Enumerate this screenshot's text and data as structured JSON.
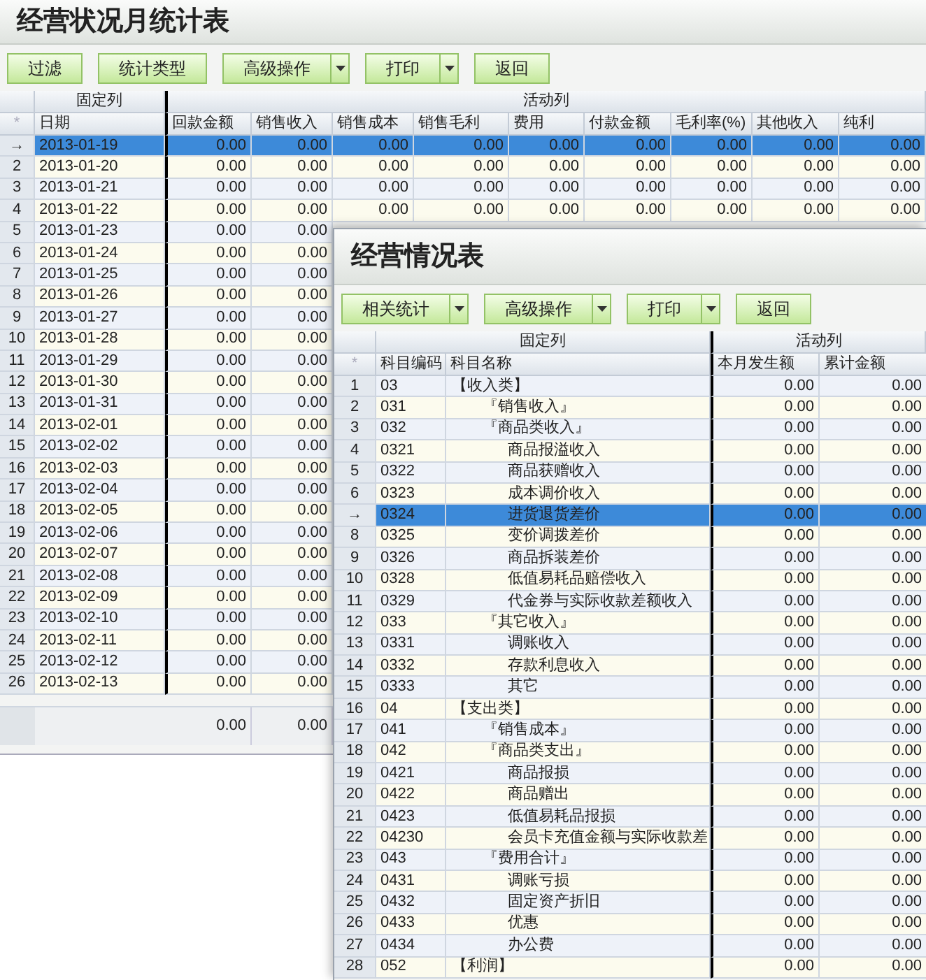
{
  "report_window": {
    "title": "经营状况月统计表",
    "toolbar": [
      {
        "label": "过滤",
        "kind": "plain"
      },
      {
        "label": "统计类型",
        "kind": "plain"
      },
      {
        "label": "高级操作",
        "kind": "split"
      },
      {
        "label": "打印",
        "kind": "split"
      },
      {
        "label": "返回",
        "kind": "plain"
      }
    ],
    "grid": {
      "groups": [
        "固定列",
        "活动列"
      ],
      "corner": "*",
      "columns": [
        "日期",
        "回款金额",
        "销售收入",
        "销售成本",
        "销售毛利",
        "费用",
        "付款金额",
        "毛利率(%)",
        "其他收入",
        "纯利"
      ],
      "rows": [
        {
          "row_no": "→",
          "selected": true,
          "date": "2013-01-19",
          "values": [
            "0.00",
            "0.00",
            "0.00",
            "0.00",
            "0.00",
            "0.00",
            "0.00",
            "0.00",
            "0.00"
          ]
        },
        {
          "row_no": "2",
          "selected": false,
          "date": "2013-01-20",
          "values": [
            "0.00",
            "0.00",
            "0.00",
            "0.00",
            "0.00",
            "0.00",
            "0.00",
            "0.00",
            "0.00"
          ]
        },
        {
          "row_no": "3",
          "selected": false,
          "date": "2013-01-21",
          "values": [
            "0.00",
            "0.00",
            "0.00",
            "0.00",
            "0.00",
            "0.00",
            "0.00",
            "0.00",
            "0.00"
          ]
        },
        {
          "row_no": "4",
          "selected": false,
          "date": "2013-01-22",
          "values": [
            "0.00",
            "0.00",
            "0.00",
            "0.00",
            "0.00",
            "0.00",
            "0.00",
            "0.00",
            "0.00"
          ]
        },
        {
          "row_no": "5",
          "selected": false,
          "date": "2013-01-23",
          "values": [
            "0.00",
            "0.00"
          ]
        },
        {
          "row_no": "6",
          "selected": false,
          "date": "2013-01-24",
          "values": [
            "0.00",
            "0.00"
          ]
        },
        {
          "row_no": "7",
          "selected": false,
          "date": "2013-01-25",
          "values": [
            "0.00",
            "0.00"
          ]
        },
        {
          "row_no": "8",
          "selected": false,
          "date": "2013-01-26",
          "values": [
            "0.00",
            "0.00"
          ]
        },
        {
          "row_no": "9",
          "selected": false,
          "date": "2013-01-27",
          "values": [
            "0.00",
            "0.00"
          ]
        },
        {
          "row_no": "10",
          "selected": false,
          "date": "2013-01-28",
          "values": [
            "0.00",
            "0.00"
          ]
        },
        {
          "row_no": "11",
          "selected": false,
          "date": "2013-01-29",
          "values": [
            "0.00",
            "0.00"
          ]
        },
        {
          "row_no": "12",
          "selected": false,
          "date": "2013-01-30",
          "values": [
            "0.00",
            "0.00"
          ]
        },
        {
          "row_no": "13",
          "selected": false,
          "date": "2013-01-31",
          "values": [
            "0.00",
            "0.00"
          ]
        },
        {
          "row_no": "14",
          "selected": false,
          "date": "2013-02-01",
          "values": [
            "0.00",
            "0.00"
          ]
        },
        {
          "row_no": "15",
          "selected": false,
          "date": "2013-02-02",
          "values": [
            "0.00",
            "0.00"
          ]
        },
        {
          "row_no": "16",
          "selected": false,
          "date": "2013-02-03",
          "values": [
            "0.00",
            "0.00"
          ]
        },
        {
          "row_no": "17",
          "selected": false,
          "date": "2013-02-04",
          "values": [
            "0.00",
            "0.00"
          ]
        },
        {
          "row_no": "18",
          "selected": false,
          "date": "2013-02-05",
          "values": [
            "0.00",
            "0.00"
          ]
        },
        {
          "row_no": "19",
          "selected": false,
          "date": "2013-02-06",
          "values": [
            "0.00",
            "0.00"
          ]
        },
        {
          "row_no": "20",
          "selected": false,
          "date": "2013-02-07",
          "values": [
            "0.00",
            "0.00"
          ]
        },
        {
          "row_no": "21",
          "selected": false,
          "date": "2013-02-08",
          "values": [
            "0.00",
            "0.00"
          ]
        },
        {
          "row_no": "22",
          "selected": false,
          "date": "2013-02-09",
          "values": [
            "0.00",
            "0.00"
          ]
        },
        {
          "row_no": "23",
          "selected": false,
          "date": "2013-02-10",
          "values": [
            "0.00",
            "0.00"
          ]
        },
        {
          "row_no": "24",
          "selected": false,
          "date": "2013-02-11",
          "values": [
            "0.00",
            "0.00"
          ]
        },
        {
          "row_no": "25",
          "selected": false,
          "date": "2013-02-12",
          "values": [
            "0.00",
            "0.00"
          ]
        },
        {
          "row_no": "26",
          "selected": false,
          "date": "2013-02-13",
          "values": [
            "0.00",
            "0.00"
          ]
        }
      ],
      "totals": [
        "0.00",
        "0.00"
      ]
    }
  },
  "detail_window": {
    "title": "经营情况表",
    "toolbar": [
      {
        "label": "相关统计",
        "kind": "split"
      },
      {
        "label": "高级操作",
        "kind": "split"
      },
      {
        "label": "打印",
        "kind": "split"
      },
      {
        "label": "返回",
        "kind": "plain"
      }
    ],
    "grid": {
      "groups": [
        "固定列",
        "活动列"
      ],
      "corner": "*",
      "columns": [
        "科目编码",
        "科目名称",
        "本月发生额",
        "累计金额"
      ],
      "rows": [
        {
          "row_no": "1",
          "selected": false,
          "code": "03",
          "name": "【收入类】",
          "this_month": "0.00",
          "cumulative": "0.00",
          "children": [
            {
              "row_no": "2",
              "selected": false,
              "code": "031",
              "name": "『销售收入』",
              "this_month": "0.00",
              "cumulative": "0.00"
            },
            {
              "row_no": "3",
              "selected": false,
              "code": "032",
              "name": "『商品类收入』",
              "this_month": "0.00",
              "cumulative": "0.00",
              "children": [
                {
                  "row_no": "4",
                  "selected": false,
                  "code": "0321",
                  "name": "商品报溢收入",
                  "this_month": "0.00",
                  "cumulative": "0.00"
                },
                {
                  "row_no": "5",
                  "selected": false,
                  "code": "0322",
                  "name": "商品获赠收入",
                  "this_month": "0.00",
                  "cumulative": "0.00"
                },
                {
                  "row_no": "6",
                  "selected": false,
                  "code": "0323",
                  "name": "成本调价收入",
                  "this_month": "0.00",
                  "cumulative": "0.00"
                },
                {
                  "row_no": "→",
                  "selected": true,
                  "code": "0324",
                  "name": "进货退货差价",
                  "this_month": "0.00",
                  "cumulative": "0.00"
                },
                {
                  "row_no": "8",
                  "selected": false,
                  "code": "0325",
                  "name": "变价调拨差价",
                  "this_month": "0.00",
                  "cumulative": "0.00"
                },
                {
                  "row_no": "9",
                  "selected": false,
                  "code": "0326",
                  "name": "商品拆装差价",
                  "this_month": "0.00",
                  "cumulative": "0.00"
                },
                {
                  "row_no": "10",
                  "selected": false,
                  "code": "0328",
                  "name": "低值易耗品赔偿收入",
                  "this_month": "0.00",
                  "cumulative": "0.00"
                },
                {
                  "row_no": "11",
                  "selected": false,
                  "code": "0329",
                  "name": "代金券与实际收款差额收入",
                  "this_month": "0.00",
                  "cumulative": "0.00"
                }
              ]
            },
            {
              "row_no": "12",
              "selected": false,
              "code": "033",
              "name": "『其它收入』",
              "this_month": "0.00",
              "cumulative": "0.00",
              "children": [
                {
                  "row_no": "13",
                  "selected": false,
                  "code": "0331",
                  "name": "调账收入",
                  "this_month": "0.00",
                  "cumulative": "0.00"
                },
                {
                  "row_no": "14",
                  "selected": false,
                  "code": "0332",
                  "name": "存款利息收入",
                  "this_month": "0.00",
                  "cumulative": "0.00"
                },
                {
                  "row_no": "15",
                  "selected": false,
                  "code": "0333",
                  "name": "其它",
                  "this_month": "0.00",
                  "cumulative": "0.00"
                }
              ]
            }
          ]
        },
        {
          "row_no": "16",
          "selected": false,
          "code": "04",
          "name": "【支出类】",
          "this_month": "0.00",
          "cumulative": "0.00",
          "children": [
            {
              "row_no": "17",
              "selected": false,
              "code": "041",
              "name": "『销售成本』",
              "this_month": "0.00",
              "cumulative": "0.00"
            },
            {
              "row_no": "18",
              "selected": false,
              "code": "042",
              "name": "『商品类支出』",
              "this_month": "0.00",
              "cumulative": "0.00",
              "children": [
                {
                  "row_no": "19",
                  "selected": false,
                  "code": "0421",
                  "name": "商品报损",
                  "this_month": "0.00",
                  "cumulative": "0.00"
                },
                {
                  "row_no": "20",
                  "selected": false,
                  "code": "0422",
                  "name": "商品赠出",
                  "this_month": "0.00",
                  "cumulative": "0.00"
                },
                {
                  "row_no": "21",
                  "selected": false,
                  "code": "0423",
                  "name": "低值易耗品报损",
                  "this_month": "0.00",
                  "cumulative": "0.00"
                },
                {
                  "row_no": "22",
                  "selected": false,
                  "code": "04230",
                  "name": "会员卡充值金额与实际收款差",
                  "this_month": "0.00",
                  "cumulative": "0.00"
                }
              ]
            },
            {
              "row_no": "23",
              "selected": false,
              "code": "043",
              "name": "『费用合计』",
              "this_month": "0.00",
              "cumulative": "0.00",
              "children": [
                {
                  "row_no": "24",
                  "selected": false,
                  "code": "0431",
                  "name": "调账亏损",
                  "this_month": "0.00",
                  "cumulative": "0.00"
                },
                {
                  "row_no": "25",
                  "selected": false,
                  "code": "0432",
                  "name": "固定资产折旧",
                  "this_month": "0.00",
                  "cumulative": "0.00"
                },
                {
                  "row_no": "26",
                  "selected": false,
                  "code": "0433",
                  "name": "优惠",
                  "this_month": "0.00",
                  "cumulative": "0.00"
                },
                {
                  "row_no": "27",
                  "selected": false,
                  "code": "0434",
                  "name": "办公费",
                  "this_month": "0.00",
                  "cumulative": "0.00"
                }
              ]
            }
          ]
        },
        {
          "row_no": "28",
          "selected": false,
          "code": "052",
          "name": "【利润】",
          "this_month": "0.00",
          "cumulative": "0.00"
        }
      ]
    }
  }
}
